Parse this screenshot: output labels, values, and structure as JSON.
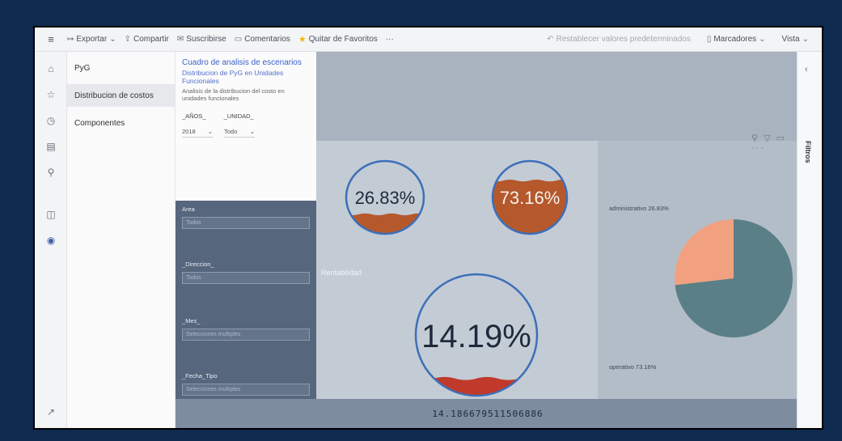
{
  "toolbar": {
    "export": "Exportar",
    "share": "Compartir",
    "subscribe": "Suscribirse",
    "comments": "Comentarios",
    "favorite": "Quitar de Favoritos",
    "more": "···",
    "reset": "Restablecer valores predeterminados",
    "bookmarks": "Marcadores",
    "view": "Vista"
  },
  "nav": {
    "items": [
      {
        "label": "PyG"
      },
      {
        "label": "Distribucion de costos"
      },
      {
        "label": "Componentes"
      }
    ]
  },
  "header_card": {
    "title": "Cuadro de analisis de escenarios",
    "subtitle": "Distribucion de PyG en Unidades Funcionales",
    "description": "Analisis de la distribucion del costo en unidades funcionales",
    "label_year": "_AÑOS_",
    "label_quarter": "_UNIDAD_",
    "select_year": "2018",
    "select_quarter": "Todo"
  },
  "slicers": [
    {
      "label": "Area",
      "value": "Todos"
    },
    {
      "label": "_Direccion_",
      "value": "Todos"
    },
    {
      "label": "_Mes_",
      "value": "Selecciones multiples"
    },
    {
      "label": "_Fecha_Tipo",
      "value": "Selecciones multiples"
    }
  ],
  "gauges": [
    {
      "label": "26.83%",
      "value": 0.2683,
      "fill_color": "#b5582c"
    },
    {
      "label": "73.16%",
      "value": 0.7316,
      "fill_color": "#b5582c"
    },
    {
      "label": "14.19%",
      "value": 0.1419,
      "fill_color": "#c0392b"
    }
  ],
  "rentabilidad_label": "Rentabilidad",
  "bottom_value": "14.186679511506886",
  "pie": {
    "slices": [
      {
        "label": "administrativo 26.83%",
        "value": 26.83,
        "color": "#f1a17f"
      },
      {
        "label": "operativo 73.16%",
        "value": 73.16,
        "color": "#5b7f86"
      }
    ]
  },
  "filters_label": "Filtros",
  "colors": {
    "accent": "#3a62c8",
    "frame_bg": "#0f2a4f",
    "gauge_ring": "#3d6fb8"
  }
}
